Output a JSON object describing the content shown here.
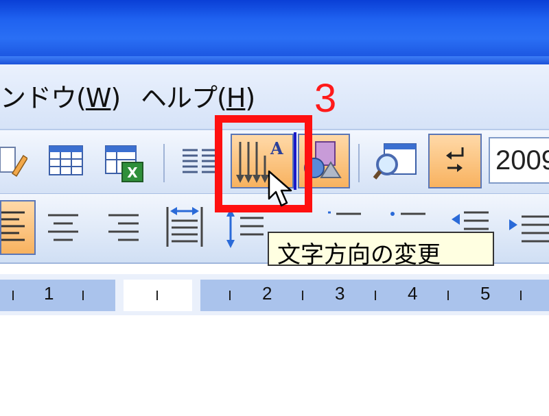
{
  "menu": {
    "window_label": "ンドウ(",
    "window_key": "W",
    "window_close": ")",
    "help_label": "ヘルプ(",
    "help_key": "H",
    "help_close": ")"
  },
  "annotation": {
    "step_number": "3"
  },
  "tooltip": {
    "text": "文字方向の変更"
  },
  "toolbar": {
    "date_value": "2009"
  },
  "ruler": {
    "numbers": [
      "1",
      "2",
      "3",
      "4",
      "5"
    ]
  },
  "colors": {
    "highlight": "#ff1010",
    "pressed": "#f8b25f",
    "titlebar": "#1f62f0"
  }
}
